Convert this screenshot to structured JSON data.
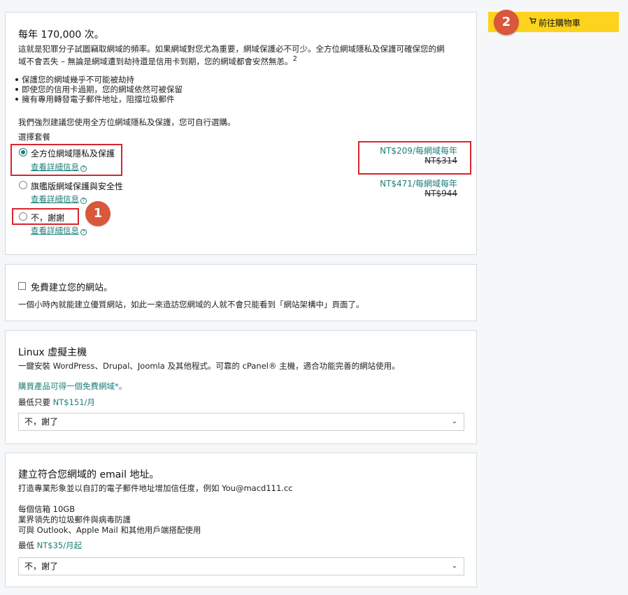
{
  "privacy_card": {
    "title": "每年 170,000 次。",
    "description_line1": "這就是犯罪分子試圖竊取網域的頻率。如果網域對您尤為重要，網域保護必不可少。全方位網域隱私及保護可確保您的網",
    "description_line2": "域不會丟失 – 無論是網域遭到劫持還是信用卡到期，您的網域都會安然無恙。",
    "footnote": "2",
    "bullets": [
      "保護您的網域幾乎不可能被劫持",
      "即使您的信用卡過期，您的網域依然可被保留",
      "擁有專用轉發電子郵件地址，阻擋垃圾郵件"
    ],
    "recommendation": "我們強烈建議您使用全方位網域隱私及保護，您可自行選購。",
    "choose_label": "選擇套餐",
    "options": [
      {
        "label": "全方位網域隱私及保護",
        "details_link": "查看詳細信息",
        "price": "NT$209",
        "per": "/每網域每年",
        "old_price": "NT$314",
        "selected": true
      },
      {
        "label": "旗艦版網域保護與安全性",
        "details_link": "查看詳細信息",
        "price": "NT$471",
        "per": "/每網域每年",
        "old_price": "NT$944",
        "selected": false
      },
      {
        "label": "不，謝謝",
        "details_link": "查看詳細信息",
        "selected": false
      }
    ]
  },
  "website_card": {
    "title": "免費建立您的網站。",
    "description": "一個小時內就能建立優質網站，如此一來造訪您網域的人就不會只能看到「網站架構中」頁面了。"
  },
  "hosting_card": {
    "title": "Linux 虛擬主機",
    "description": "一鍵安裝 WordPress、Drupal、Joomla 及其他程式。可靠的 cPanel® 主機，適合功能完善的網站使用。",
    "promo": "購買產品可得一個免費網域*。",
    "price_prefix": "最低只要 ",
    "price": "NT$151/月",
    "select_value": "不，謝了"
  },
  "email_card": {
    "title": "建立符合您網域的 email 地址。",
    "description": "打造專業形象並以自訂的電子郵件地址增加信任度，例如 You@macd111.cc",
    "features": [
      "每個信箱 10GB",
      "業界領先的垃圾郵件與病毒防護",
      "可與 Outlook、Apple Mail 和其他用戶端搭配使用"
    ],
    "price_prefix": "最低 ",
    "price": "NT$35/月起",
    "select_value": "不，謝了"
  },
  "cart_button": {
    "label": "前往購物車",
    "icon": "cart-icon"
  },
  "annotations": {
    "badge1": "1",
    "badge2": "2"
  },
  "colors": {
    "accent_teal": "#1b7f7a",
    "cart_yellow": "#fed31e",
    "annotation_red": "#d9242f",
    "badge_orange": "#d9573a"
  }
}
